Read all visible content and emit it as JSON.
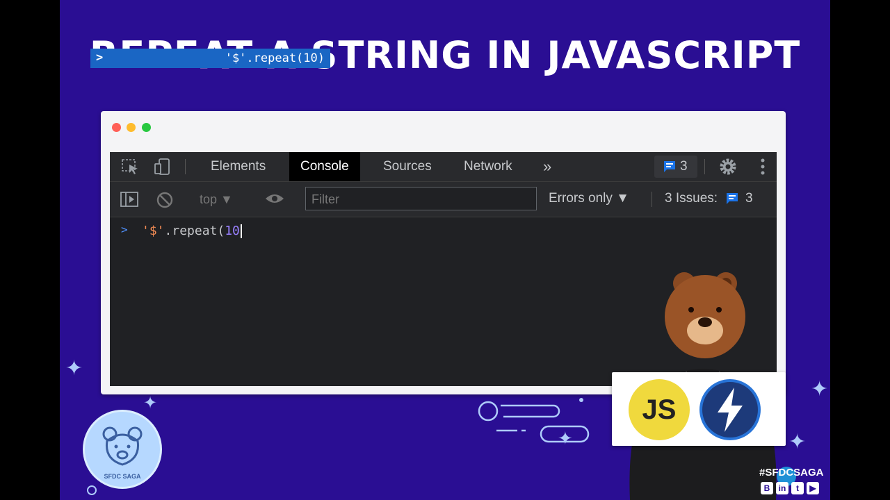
{
  "slide": {
    "title": "REPEAT A STRING IN JAVASCRIPT",
    "hashtag": "#SFDCSAGA",
    "badge_text": "SFDC SAGA",
    "logos": {
      "js_text": "JS",
      "second_logo": "lightning-bolt-icon"
    },
    "social_icons": [
      "blogger-icon",
      "linkedin-icon",
      "twitter-icon",
      "youtube-icon"
    ],
    "colors": {
      "background": "#2a0e93",
      "devtools_bg": "#202124",
      "autocomplete_bg": "#1a66c4",
      "string_color": "#f28b54",
      "number_color": "#9980ff"
    }
  },
  "devtools": {
    "tabs": [
      {
        "label": "Elements",
        "active": false
      },
      {
        "label": "Console",
        "active": true
      },
      {
        "label": "Sources",
        "active": false
      },
      {
        "label": "Network",
        "active": false
      }
    ],
    "more_tabs_label": "»",
    "issues_badge_count": "3",
    "toolbar": {
      "context": "top ▼",
      "filter_placeholder": "Filter",
      "levels_label": "Errors only ▼",
      "issues_label": "3 Issues:",
      "issues_count": "3"
    },
    "console": {
      "prompt": ">",
      "input_string": "'$'",
      "input_method": ".repeat(",
      "input_number": "10",
      "autocomplete_chevron": ">",
      "autocomplete_suggestion": "'$'.repeat(10)"
    }
  }
}
